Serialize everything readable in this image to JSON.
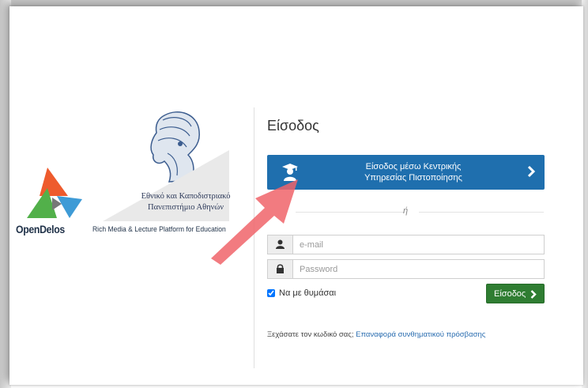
{
  "brand": {
    "university_line1": "Εθνικό και Καποδιστριακό",
    "university_line2": "Πανεπιστήμιο Αθηνών",
    "platform_name": "OpenDelos",
    "tagline": "Rich Media & Lecture Platform for Education"
  },
  "login": {
    "title": "Είσοδος",
    "sso_line1": "Είσοδος μέσω Κεντρικής",
    "sso_line2": "Υπηρεσίας Πιστοποίησης",
    "or_text": "ή",
    "email_placeholder": "e-mail",
    "password_placeholder": "Password",
    "remember_label": "Να με θυμάσαι",
    "remember_checked": true,
    "submit_label": "Είσοδος",
    "forgot_question": "Ξεχάσατε τον κωδικό σας;",
    "forgot_link": "Επαναφορά συνθηματικού πρόσβασης"
  },
  "colors": {
    "sso_button": "#1f6fae",
    "submit_button": "#2f7d32",
    "link": "#2a6db0",
    "annotation_arrow": "#f0646a"
  },
  "icons": {
    "sso": "graduate-user-icon",
    "sso_chevron": "chevron-right-icon",
    "email": "user-icon",
    "password": "lock-icon",
    "submit": "chevron-right-icon"
  }
}
